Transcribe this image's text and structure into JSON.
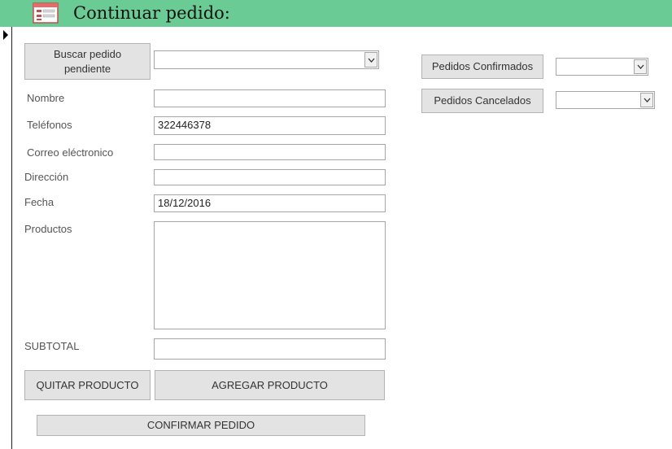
{
  "header": {
    "title": "Continuar pedido:",
    "icon": "form-icon",
    "background": "#6bcb95"
  },
  "record_selector": {
    "icon": "current-record-arrow-icon"
  },
  "form": {
    "search_button_label": "Buscar pedido pendiente",
    "search_combo_value": "",
    "fields": {
      "nombre": {
        "label": "Nombre",
        "value": ""
      },
      "telefonos": {
        "label": "Teléfonos",
        "value": "322446378"
      },
      "correo": {
        "label": "Correo eléctronico",
        "value": ""
      },
      "direccion": {
        "label": "Dirección",
        "value": ""
      },
      "fecha": {
        "label": "Fecha",
        "value": "18/12/2016"
      },
      "productos": {
        "label": "Productos",
        "value": ""
      },
      "subtotal": {
        "label": "SUBTOTAL",
        "value": ""
      }
    },
    "buttons": {
      "quitar": "QUITAR PRODUCTO",
      "agregar": "AGREGAR PRODUCTO",
      "confirmar": "CONFIRMAR PEDIDO"
    }
  },
  "side": {
    "confirmados_label": "Pedidos Confirmados",
    "confirmados_value": "",
    "cancelados_label": "Pedidos Cancelados",
    "cancelados_value": ""
  },
  "icons": {
    "dropdown": "chevron-down-icon"
  }
}
